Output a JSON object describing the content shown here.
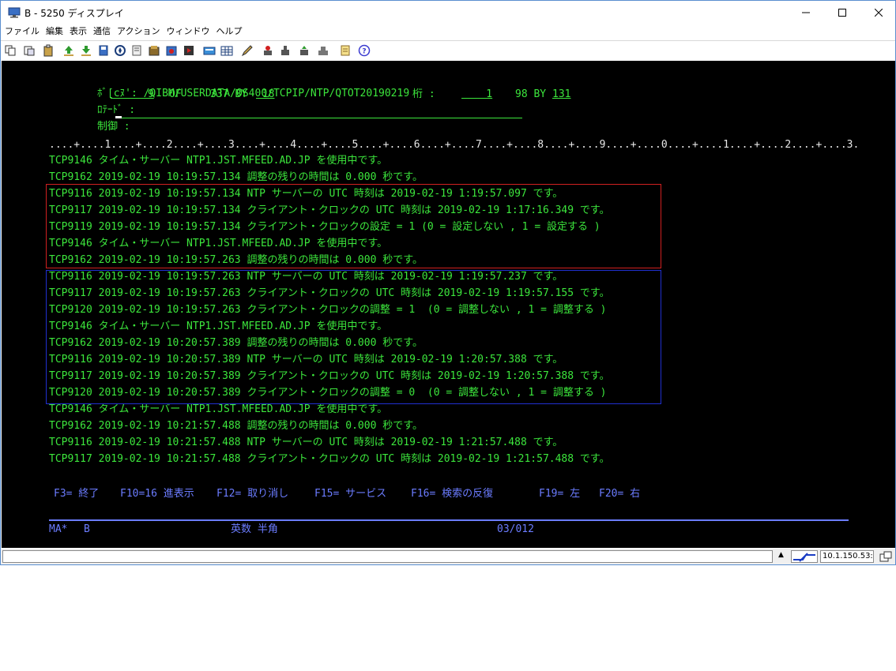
{
  "window": {
    "title": "B - 5250 ディスプレイ"
  },
  "menu": [
    "ファイル",
    "編集",
    "表示",
    "通信",
    "アクション",
    "ウィンドウ",
    "ヘルプ"
  ],
  "toolbar_icons": [
    "copy-icon",
    "paste-icon",
    "clipboard-icon",
    "upload-icon",
    "download-icon",
    "save-icon",
    "navigate-icon",
    "document-icon",
    "macro-icon",
    "record-icon",
    "play-icon",
    "keyboard-icon",
    "keypad-icon",
    "pen-icon",
    "transfer-icon",
    "send-icon",
    "receive-icon",
    "print-icon",
    "notes-icon",
    "help-icon"
  ],
  "terminal": {
    "header": {
      "path_label": "ﾎﾞ[cﾇ':",
      "path_value": "/QIBM/USERDATA/OS400/TCPIP/NTP/QTOT20190219",
      "record_label": "ﾛﾃｰﾄﾞ :",
      "record_current": "9",
      "record_of": "OF",
      "record_total": "337",
      "record_by": "BY",
      "record_width": "18",
      "column_label": "桁 :",
      "column_current": "1",
      "column_total": "98",
      "column_by": "BY",
      "column_width": "131",
      "control_label": "制御 :"
    },
    "ruler": "....+....1....+....2....+....3....+....4....+....5....+....6....+....7....+....8....+....9....+....0....+....1....+....2....+....3.",
    "lines": [
      "TCP9146 タイム・サーバー NTP1.JST.MFEED.AD.JP を使用中です。",
      "TCP9162 2019-02-19 10:19:57.134 調整の残りの時間は 0.000 秒です。",
      "TCP9116 2019-02-19 10:19:57.134 NTP サーバーの UTC 時刻は 2019-02-19 1:19:57.097 です。",
      "TCP9117 2019-02-19 10:19:57.134 クライアント・クロックの UTC 時刻は 2019-02-19 1:17:16.349 です。",
      "TCP9119 2019-02-19 10:19:57.134 クライアント・クロックの設定 = 1 (0 = 設定しない , 1 = 設定する )",
      "TCP9146 タイム・サーバー NTP1.JST.MFEED.AD.JP を使用中です。",
      "TCP9162 2019-02-19 10:19:57.263 調整の残りの時間は 0.000 秒です。",
      "TCP9116 2019-02-19 10:19:57.263 NTP サーバーの UTC 時刻は 2019-02-19 1:19:57.237 です。",
      "TCP9117 2019-02-19 10:19:57.263 クライアント・クロックの UTC 時刻は 2019-02-19 1:19:57.155 です。",
      "TCP9120 2019-02-19 10:19:57.263 クライアント・クロックの調整 = 1  (0 = 調整しない , 1 = 調整する )",
      "TCP9146 タイム・サーバー NTP1.JST.MFEED.AD.JP を使用中です。",
      "TCP9162 2019-02-19 10:20:57.389 調整の残りの時間は 0.000 秒です。",
      "TCP9116 2019-02-19 10:20:57.389 NTP サーバーの UTC 時刻は 2019-02-19 1:20:57.388 です。",
      "TCP9117 2019-02-19 10:20:57.389 クライアント・クロックの UTC 時刻は 2019-02-19 1:20:57.388 です。",
      "TCP9120 2019-02-19 10:20:57.389 クライアント・クロックの調整 = 0  (0 = 調整しない , 1 = 調整する )",
      "TCP9146 タイム・サーバー NTP1.JST.MFEED.AD.JP を使用中です。",
      "TCP9162 2019-02-19 10:21:57.488 調整の残りの時間は 0.000 秒です。",
      "TCP9116 2019-02-19 10:21:57.488 NTP サーバーの UTC 時刻は 2019-02-19 1:21:57.488 です。",
      "TCP9117 2019-02-19 10:21:57.488 クライアント・クロックの UTC 時刻は 2019-02-19 1:21:57.488 です。"
    ],
    "function_keys": [
      "F3= 終了",
      "F10=16 進表示",
      "F12= 取り消し",
      "F15= サービス",
      "F16= 検索の反復",
      "F19= 左",
      "F20= 右"
    ],
    "status": {
      "session": "MA*",
      "session_id": "B",
      "input_mode": "英数 半角",
      "cursor_pos": "03/012"
    }
  },
  "statusbar": {
    "host": "10.1.150.53:23"
  },
  "colors": {
    "terminal_bg": "#000000",
    "text_green": "#3ce63c",
    "text_blue": "#6b7cff",
    "highlight_red": "#d02020",
    "highlight_blue": "#2030d0"
  }
}
